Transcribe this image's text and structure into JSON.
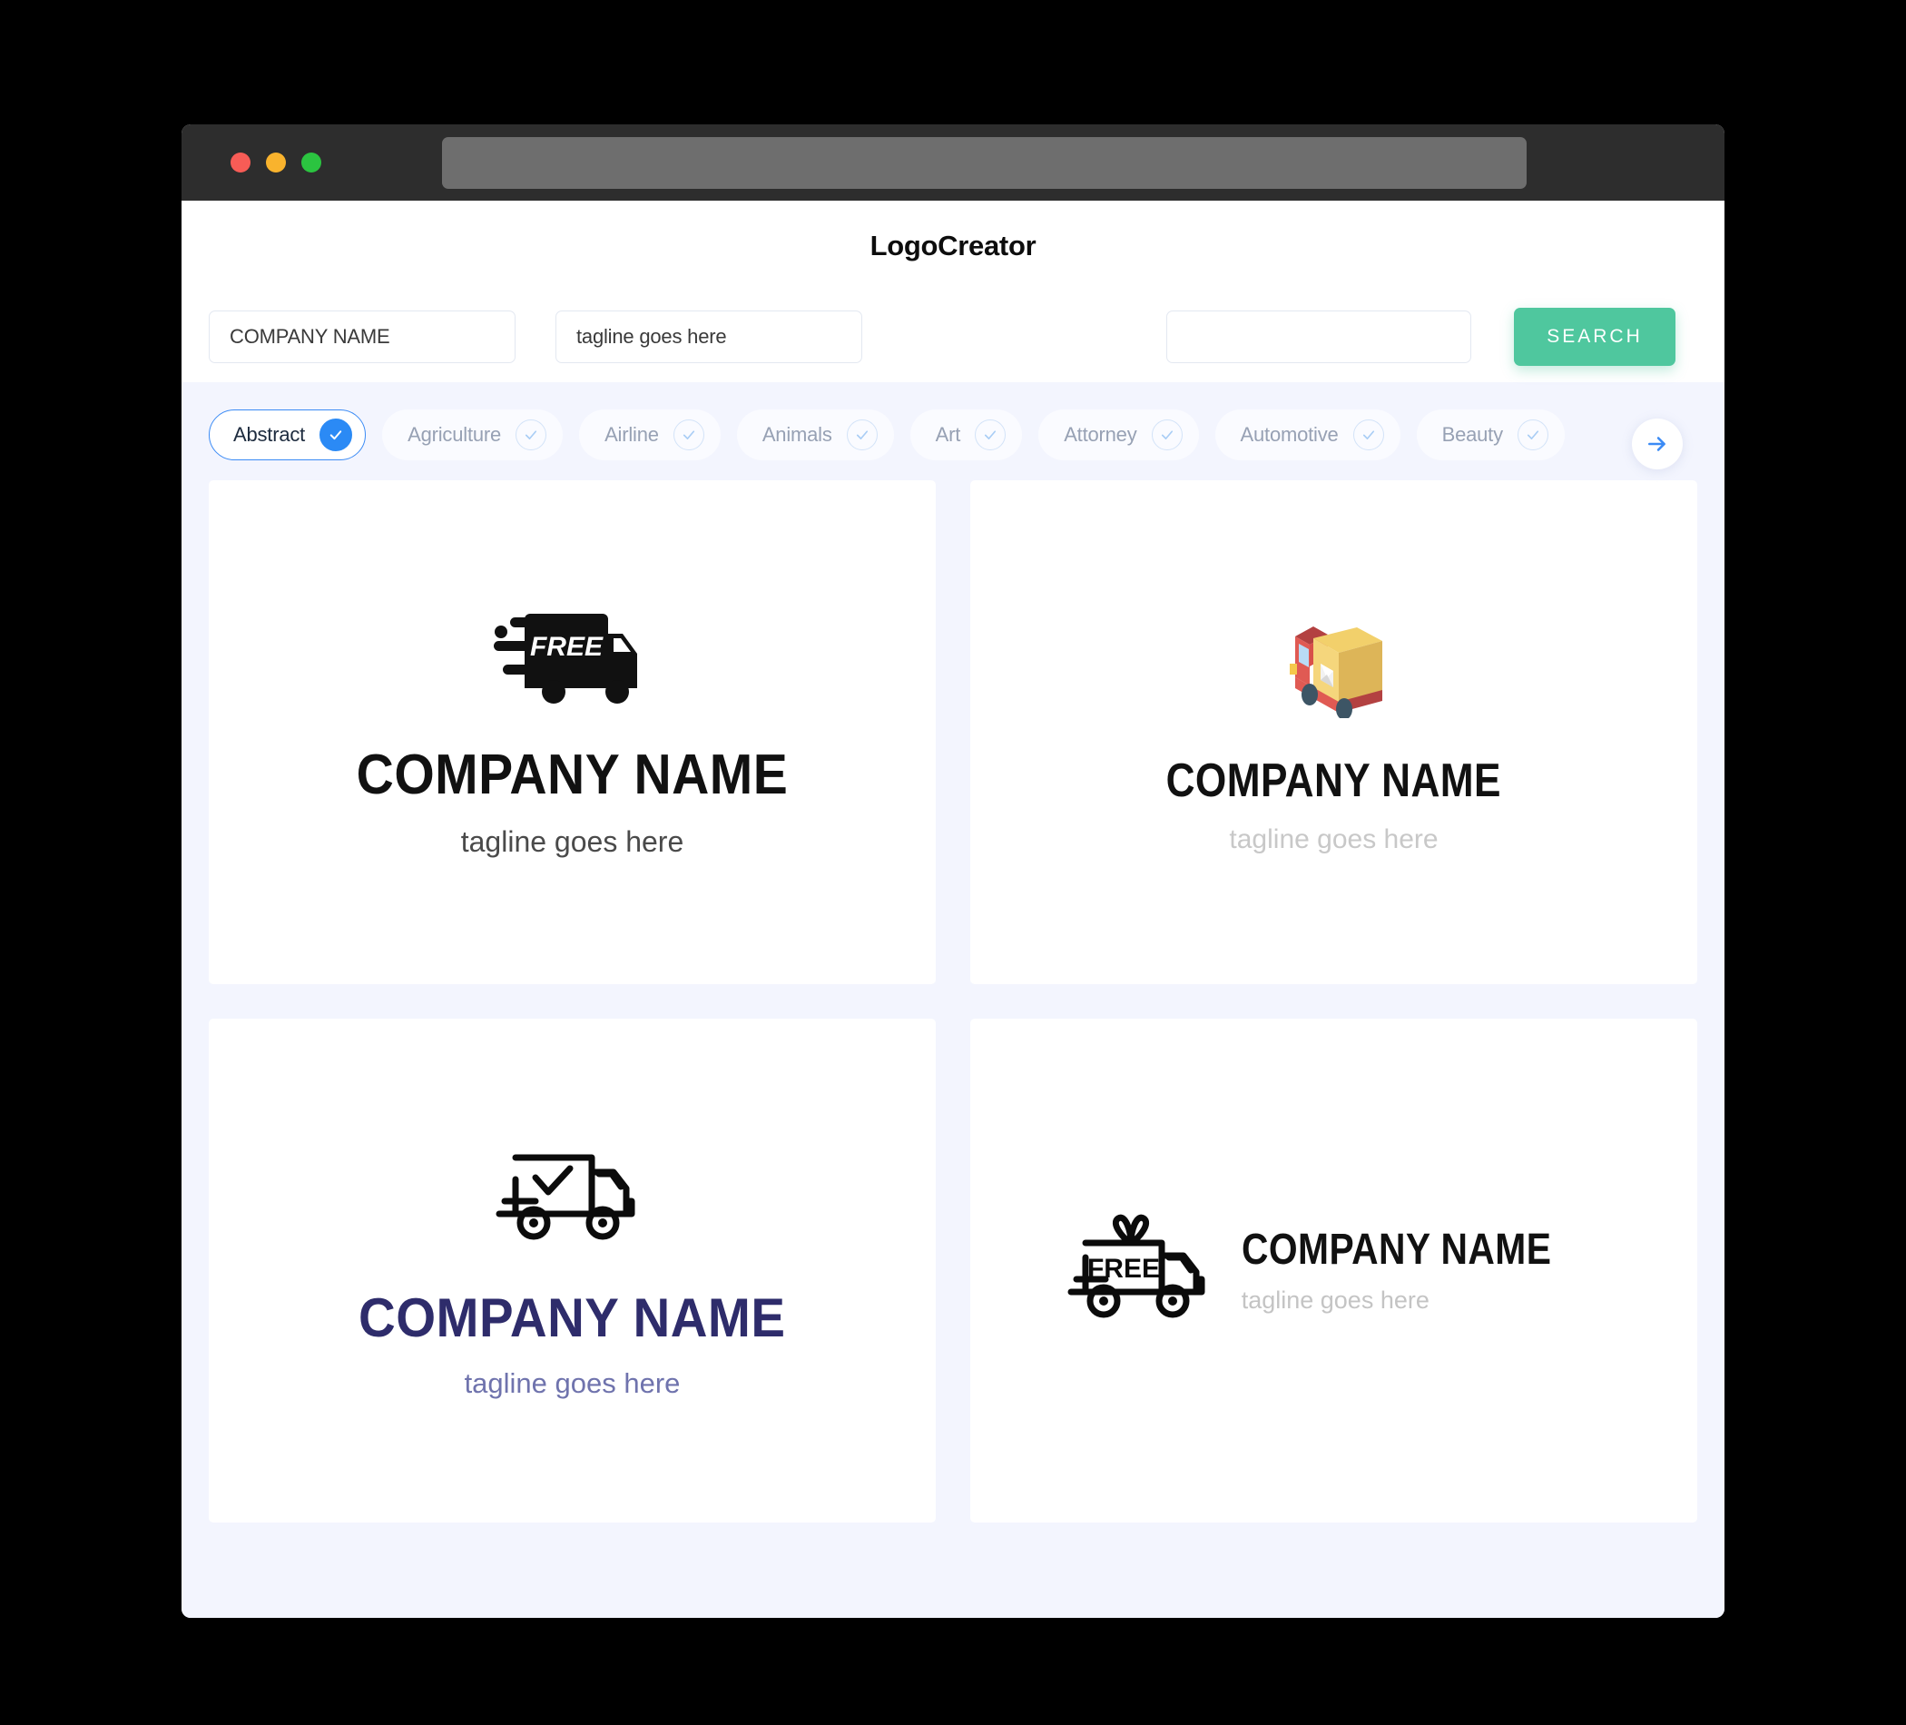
{
  "window": {
    "traffic_lights": [
      {
        "name": "close",
        "color": "#f75c56"
      },
      {
        "name": "minimize",
        "color": "#f9b32d"
      },
      {
        "name": "maximize",
        "color": "#2bc440"
      }
    ],
    "url_value": ""
  },
  "header": {
    "title": "LogoCreator"
  },
  "search": {
    "company_value": "COMPANY NAME",
    "tagline_value": "tagline goes here",
    "third_value": "",
    "third_placeholder": "",
    "button_label": "SEARCH",
    "button_color": "#4fc79e"
  },
  "categories": {
    "items": [
      {
        "label": "Abstract",
        "selected": true
      },
      {
        "label": "Agriculture",
        "selected": false
      },
      {
        "label": "Airline",
        "selected": false
      },
      {
        "label": "Animals",
        "selected": false
      },
      {
        "label": "Art",
        "selected": false
      },
      {
        "label": "Attorney",
        "selected": false
      },
      {
        "label": "Automotive",
        "selected": false
      },
      {
        "label": "Beauty",
        "selected": false
      }
    ],
    "next_icon": "arrow-right-icon",
    "accent_color": "#3b8bf5"
  },
  "logos": [
    {
      "icon": "delivery-truck-free-solid-icon",
      "icon_badge": "FREE",
      "name": "COMPANY NAME",
      "tagline": "tagline goes here",
      "name_color": "#111111",
      "tagline_color": "#4a4a4a",
      "layout": "stacked"
    },
    {
      "icon": "isometric-mail-truck-icon",
      "icon_badge": "",
      "name": "COMPANY NAME",
      "tagline": "tagline goes here",
      "name_color": "#111111",
      "tagline_color": "#c8c8c8",
      "layout": "stacked"
    },
    {
      "icon": "delivery-truck-check-outline-icon",
      "icon_badge": "",
      "name": "COMPANY NAME",
      "tagline": "tagline goes here",
      "name_color": "#2e2c6b",
      "tagline_color": "#6f73ad",
      "layout": "stacked"
    },
    {
      "icon": "gift-truck-free-outline-icon",
      "icon_badge": "FREE",
      "name": "COMPANY NAME",
      "tagline": "tagline goes here",
      "name_color": "#111111",
      "tagline_color": "#c4c4c4",
      "layout": "horizontal"
    }
  ]
}
